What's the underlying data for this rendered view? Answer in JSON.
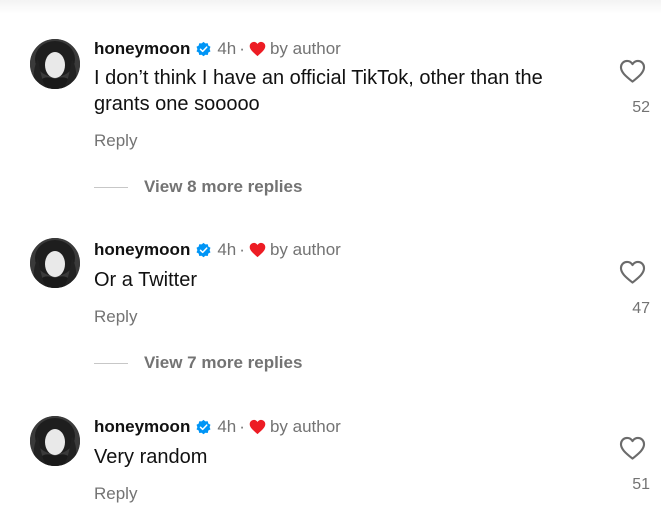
{
  "comments": [
    {
      "username": "honeymoon",
      "time": "4h",
      "separator": "·",
      "author_badge": "by author",
      "text": "I don’t think I have an official TikTok, other than the grants one sooooo",
      "reply_label": "Reply",
      "likes": "52",
      "view_replies": "View 8 more replies"
    },
    {
      "username": "honeymoon",
      "time": "4h",
      "separator": "·",
      "author_badge": "by author",
      "text": "Or a Twitter",
      "reply_label": "Reply",
      "likes": "47",
      "view_replies": "View 7 more replies"
    },
    {
      "username": "honeymoon",
      "time": "4h",
      "separator": "·",
      "author_badge": "by author",
      "text": "Very random",
      "reply_label": "Reply",
      "likes": "51"
    }
  ],
  "icons": {
    "verified": "verified-badge-icon",
    "author_heart": "heart-filled-icon",
    "like": "heart-outline-icon"
  },
  "colors": {
    "verified_blue": "#0095f6",
    "heart_red": "#ed1c24",
    "muted_text": "#737373"
  }
}
